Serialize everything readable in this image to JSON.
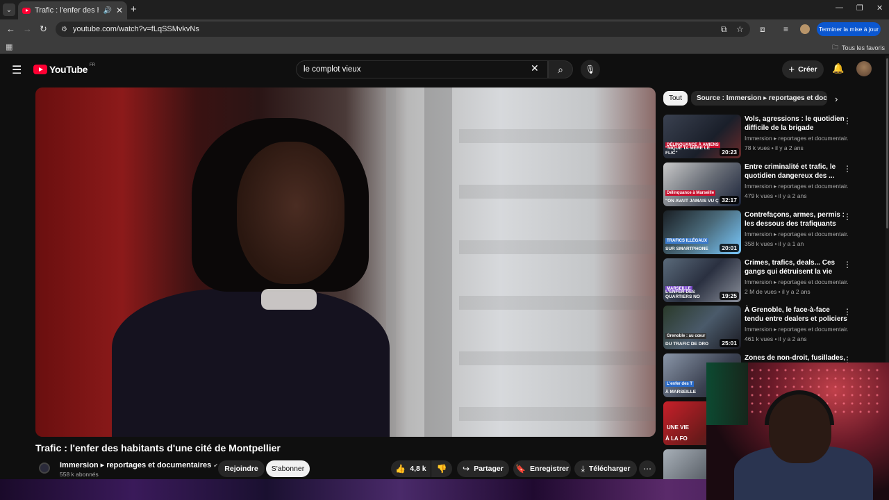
{
  "browser": {
    "tab_title": "Trafic : l'enfer des habitants d'une cité de Montpellier",
    "url": "youtube.com/watch?v=fLqSSMvkvNs",
    "update_button": "Terminer la mise à jour",
    "bookmarks_folder": "Tous les favoris"
  },
  "youtube": {
    "logo_text": "YouTube",
    "country_code": "FR",
    "search_query": "le complot vieux",
    "create_label": "Créer"
  },
  "video": {
    "title": "Trafic : l'enfer des habitants d'une cité de Montpellier",
    "channel": "Immersion ▸ reportages et documentaires",
    "subscribers": "558 k abonnés",
    "join_label": "Rejoindre",
    "subscribe_label": "S'abonner",
    "likes": "4,8 k",
    "share_label": "Partager",
    "save_label": "Enregistrer",
    "download_label": "Télécharger"
  },
  "chips": {
    "all": "Tout",
    "source": "Source : Immersion ▸ reportages et documentaires"
  },
  "recommendations": [
    {
      "title": "Vols, agressions : le quotidien difficile de la brigade nocturne...",
      "channel": "Immersion ▸ reportages et documentair...",
      "meta": "78 k vues • il y a 2 ans",
      "duration": "20:23",
      "badge": "DÉLINQUANCE À AMIENS",
      "overlay": "\"NIQUE TA MÈRE LE FLIC\""
    },
    {
      "title": "Entre criminalité et trafic, le quotidien dangereux des ...",
      "channel": "Immersion ▸ reportages et documentair...",
      "meta": "479 k vues • il y a 2 ans",
      "duration": "32:17",
      "badge": "Délinquance à Marseille",
      "overlay": "\"ON AVAIT JAMAIS VU Ç"
    },
    {
      "title": "Contrefaçons, armes, permis : les dessous des trafiquants",
      "channel": "Immersion ▸ reportages et documentair...",
      "meta": "358 k vues • il y a 1 an",
      "duration": "20:01",
      "badge": "TRAFICS ILLÉGAUX",
      "overlay": "SUR SMARTPHONE"
    },
    {
      "title": "Crimes, trafics, deals... Ces gangs qui détruisent la vie des...",
      "channel": "Immersion ▸ reportages et documentair...",
      "meta": "2 M de vues • il y a 2 ans",
      "duration": "19:25",
      "badge": "MARSEILLE",
      "overlay": "L'ENFER DES QUARTIERS NO"
    },
    {
      "title": "À Grenoble, le face-à-face tendu entre dealers et policiers",
      "channel": "Immersion ▸ reportages et documentair...",
      "meta": "461 k vues • il y a 2 ans",
      "duration": "25:01",
      "badge": "Grenoble : au cœur",
      "overlay": "DU TRAFIC DE DRO"
    },
    {
      "title": "Zones de non-droit, fusillades,",
      "channel": "",
      "meta": "",
      "duration": "",
      "badge": "L'enfer des T",
      "overlay": "À MARSEILLE"
    },
    {
      "title": "",
      "channel": "",
      "meta": "",
      "duration": "",
      "badge": "UNE VIE",
      "overlay": "À LA FO"
    },
    {
      "title": "",
      "channel": "",
      "meta": "",
      "duration": "",
      "badge": "",
      "overlay": ""
    }
  ]
}
